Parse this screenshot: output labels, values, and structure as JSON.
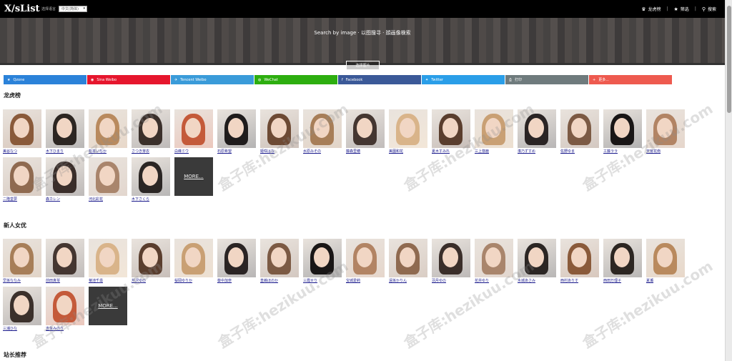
{
  "header": {
    "logo": "X/sList",
    "lang_label": "选择语言",
    "lang_value": "中文(简体)",
    "nav": [
      {
        "label": "龙虎榜",
        "icon": "crown-icon",
        "glyph": "♛"
      },
      {
        "label": "筛选",
        "icon": "star-icon",
        "glyph": "★"
      },
      {
        "label": "搜索",
        "icon": "search-icon",
        "glyph": "⚲"
      }
    ],
    "separator": "|"
  },
  "hero": {
    "title": "Search by image · 以图搜寻 · 顔画像検索",
    "button": "选择图片"
  },
  "shares": [
    {
      "label": "Qzone",
      "color": "#2b82d9",
      "icon": "qzone-icon",
      "glyph": "★"
    },
    {
      "label": "Sina Weibo",
      "color": "#e6162d",
      "icon": "weibo-icon",
      "glyph": "◉"
    },
    {
      "label": "Tencent Weibo",
      "color": "#3a9bd9",
      "icon": "tencent-weibo-icon",
      "glyph": "✈"
    },
    {
      "label": "WeChat",
      "color": "#2dae0f",
      "icon": "wechat-icon",
      "glyph": "◍"
    },
    {
      "label": "Facebook",
      "color": "#3b5998",
      "icon": "facebook-icon",
      "glyph": "f"
    },
    {
      "label": "Twitter",
      "color": "#2a9ee8",
      "icon": "twitter-icon",
      "glyph": "✦"
    },
    {
      "label": "打印",
      "color": "#6f7b7d",
      "icon": "print-icon",
      "glyph": "⎙"
    },
    {
      "label": "更多...",
      "color": "#ee5a4f",
      "icon": "plus-icon",
      "glyph": "+"
    }
  ],
  "sections": [
    {
      "title": "龙虎榜",
      "actresses": [
        "美谷なつ",
        "木下ひまり",
        "松本いちか",
        "さつき芽衣",
        "白峰ミウ",
        "石原希望",
        "姫咲はな",
        "水原みその",
        "藤森里穂",
        "美園和花",
        "夏木すみれ",
        "三上悠亜",
        "湊乃ずすめ",
        "佐野ゆま",
        "工藤ララ",
        "天宮花南",
        "二階堂夢",
        "森カレン",
        "河北彩花",
        "木下さくら"
      ],
      "more": "MORE..."
    },
    {
      "title": "新人女优",
      "actresses": [
        "早坂ななみ",
        "前田真琴",
        "菊池千尋",
        "芹沢ゆの",
        "桜岡ゆりか",
        "葵中加奈",
        "直嶋ほのか",
        "三霞せり",
        "宝城愛莉",
        "遠坂かりん",
        "羽月ゆの",
        "花井ゆり",
        "水城あさみ",
        "西村ありす",
        "西田万理子",
        "夏瀬",
        "三浦ひな",
        "吉永みのり"
      ],
      "more": "MORE..."
    },
    {
      "title": "站长推荐"
    }
  ],
  "watermark": "盒子库:hezikuu.com",
  "photo_colors": [
    "#8a5a3a",
    "#2c2622",
    "#b98a5e",
    "#3b302b",
    "#c45a3a",
    "#1f1c1c",
    "#6d4a34",
    "#a77e58",
    "#443631",
    "#d9b48a",
    "#5a3e2e",
    "#c9a074",
    "#2a2424",
    "#7c5a44",
    "#191616",
    "#b28464",
    "#8f6a50",
    "#3a2e2a",
    "#a9856c",
    "#2b2624"
  ]
}
